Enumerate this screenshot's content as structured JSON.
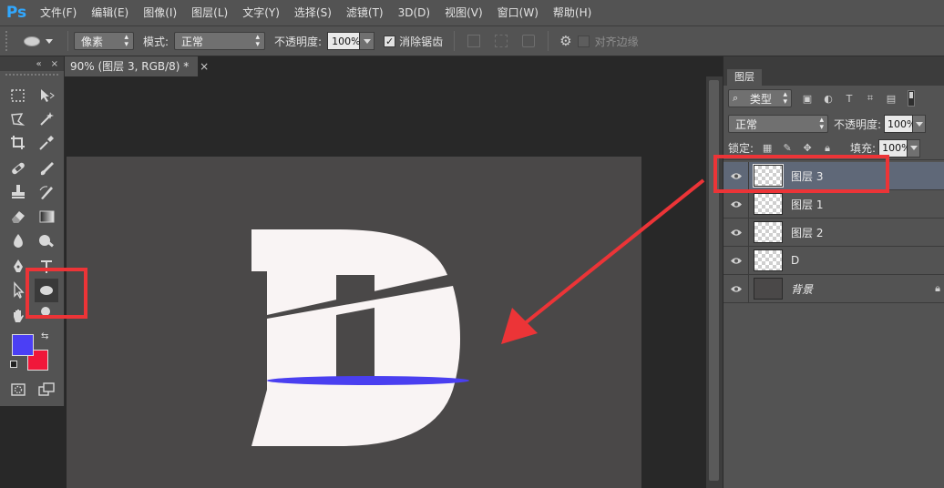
{
  "app": {
    "logo": "Ps"
  },
  "menu": [
    "文件(F)",
    "编辑(E)",
    "图像(I)",
    "图层(L)",
    "文字(Y)",
    "选择(S)",
    "滤镜(T)",
    "3D(D)",
    "视图(V)",
    "窗口(W)",
    "帮助(H)"
  ],
  "options": {
    "mode_select": "像素",
    "mode_label": "模式:",
    "blend_select": "正常",
    "opacity_label": "不透明度:",
    "opacity_value": "100%",
    "antialias_label": "消除锯齿",
    "antialias_checked": true,
    "align_edges_label": "对齐边缘",
    "align_edges_checked": false
  },
  "document": {
    "tab_title": "90% (图层 3, RGB/8) *",
    "canvas_color": "#4a4848",
    "letter_color": "#f9f4f4",
    "ellipse_color": "#4a3ff0"
  },
  "colors": {
    "foreground": "#4b3ff5",
    "background": "#f0173a",
    "annotation": "#ec3437"
  },
  "tools": [
    "marquee-icon",
    "move-icon",
    "lasso-icon",
    "magic-wand-icon",
    "crop-icon",
    "eyedropper-icon",
    "healing-icon",
    "brush-icon",
    "stamp-icon",
    "history-brush-icon",
    "eraser-icon",
    "gradient-icon",
    "blur-icon",
    "dodge-icon",
    "pen-icon",
    "type-icon",
    "path-select-icon",
    "ellipse-tool-icon",
    "hand-icon",
    "zoom-icon"
  ],
  "layers_panel": {
    "tab": "图层",
    "kind_filter": "类型",
    "blend_mode": "正常",
    "opacity_label": "不透明度:",
    "opacity_value": "100%",
    "lock_label": "锁定:",
    "fill_label": "填充:",
    "fill_value": "100%",
    "layers": [
      {
        "name": "图层 3",
        "selected": true,
        "thumb": "transparent"
      },
      {
        "name": "图层 1",
        "selected": false,
        "thumb": "transparent"
      },
      {
        "name": "图层 2",
        "selected": false,
        "thumb": "transparent"
      },
      {
        "name": "D",
        "selected": false,
        "thumb": "transparent"
      },
      {
        "name": "背景",
        "selected": false,
        "thumb": "solid",
        "locked": true
      }
    ]
  }
}
